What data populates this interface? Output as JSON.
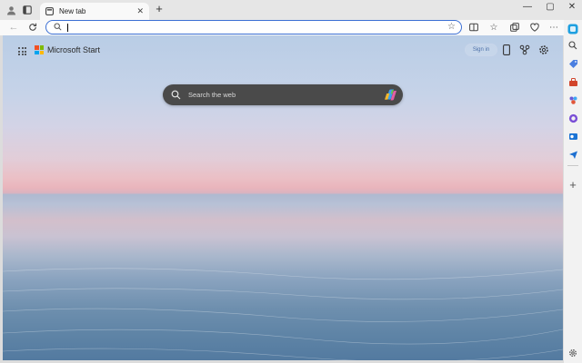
{
  "browser": {
    "tab": {
      "title": "New tab"
    },
    "address_bar": {
      "value": "",
      "placeholder": ""
    }
  },
  "page": {
    "brand": "Microsoft Start",
    "sign_in_label": "Sign in",
    "search_placeholder": "Search the web"
  },
  "colors": {
    "accent": "#3b6fd4",
    "search_bg": "#4a4a4a",
    "ms_logo": [
      "#f25022",
      "#7fba00",
      "#00a4ef",
      "#ffb900"
    ]
  },
  "icons": {
    "titlebar": [
      "profile-icon",
      "workspaces-icon",
      "new-tab-icon"
    ],
    "toolbar": [
      "back-icon",
      "refresh-icon",
      "search-icon",
      "favorite-star-icon",
      "split-screen-icon",
      "favorites-icon",
      "collections-icon",
      "browser-essentials-icon",
      "more-icon"
    ],
    "sidebar": [
      "copilot-icon",
      "search-icon",
      "shopping-icon",
      "tools-icon",
      "games-icon",
      "office-icon",
      "outlook-icon",
      "drop-icon",
      "add-icon",
      "settings-icon"
    ],
    "page": [
      "apps-grid-icon",
      "mobile-icon",
      "rewards-icon",
      "settings-icon",
      "copilot-icon"
    ]
  }
}
